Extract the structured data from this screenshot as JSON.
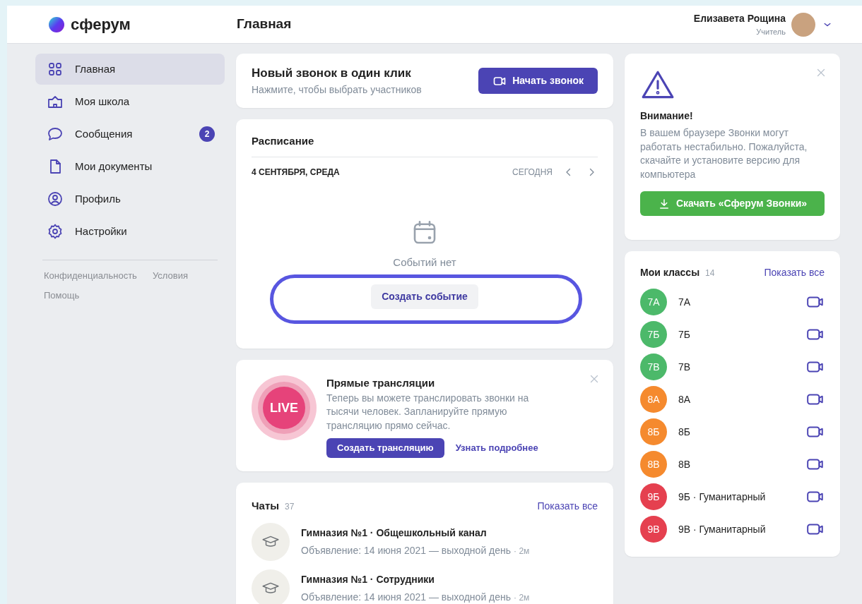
{
  "header": {
    "logo": "сферум",
    "title": "Главная",
    "user": {
      "name": "Елизавета Рощина",
      "role": "Учитель"
    }
  },
  "sidebar": {
    "items": [
      {
        "label": "Главная",
        "selected": true
      },
      {
        "label": "Моя школа",
        "selected": false
      },
      {
        "label": "Сообщения",
        "selected": false,
        "badge": "2"
      },
      {
        "label": "Мои документы",
        "selected": false
      },
      {
        "label": "Профиль",
        "selected": false
      },
      {
        "label": "Настройки",
        "selected": false
      }
    ],
    "footer_links": [
      "Конфиденциальность",
      "Условия",
      "Помощь"
    ]
  },
  "call_card": {
    "title": "Новый звонок в один клик",
    "subtitle": "Нажмите, чтобы выбрать участников",
    "button": "Начать звонок"
  },
  "schedule": {
    "title": "Расписание",
    "date": "4 СЕНТЯБРЯ, СРЕДА",
    "today": "СЕГОДНЯ",
    "empty": "Событий нет",
    "button": "Создать событие"
  },
  "live": {
    "badge": "LIVE",
    "title": "Прямые трансляции",
    "text": "Теперь вы можете транслировать звонки на тысячи человек. Запланируйте прямую трансляцию прямо сейчас.",
    "button": "Создать трансляцию",
    "link": "Узнать подробнее"
  },
  "chats": {
    "title": "Чаты",
    "count": "37",
    "show_all": "Показать все",
    "items": [
      {
        "name": "Гимназия №1 · Общешкольный канал",
        "message": "Объявление: 14 июня 2021 — выходной день",
        "time": "· 2м"
      },
      {
        "name": "Гимназия №1 · Сотрудники",
        "message": "Объявление: 14 июня 2021 — выходной день",
        "time": "· 2м"
      }
    ]
  },
  "warning": {
    "title": "Внимание!",
    "text": "В вашем браузере Звонки могут работать нестабильно. Пожалуйста, скачайте и установите версию для компьютера",
    "button": "Скачать «Сферум Звонки»"
  },
  "classes": {
    "title": "Мои классы",
    "count": "14",
    "show_all": "Показать все",
    "items": [
      {
        "short": "7А",
        "name": "7А",
        "color": "#4cb96a"
      },
      {
        "short": "7Б",
        "name": "7Б",
        "color": "#4cb96a"
      },
      {
        "short": "7В",
        "name": "7В",
        "color": "#4cb96a"
      },
      {
        "short": "8А",
        "name": "8А",
        "color": "#f58a2e"
      },
      {
        "short": "8Б",
        "name": "8Б",
        "color": "#f58a2e"
      },
      {
        "short": "8В",
        "name": "8В",
        "color": "#f58a2e"
      },
      {
        "short": "9Б",
        "name": "9Б · Гуманитарный",
        "color": "#e5404f"
      },
      {
        "short": "9В",
        "name": "9В · Гуманитарный",
        "color": "#e5404f"
      }
    ]
  }
}
